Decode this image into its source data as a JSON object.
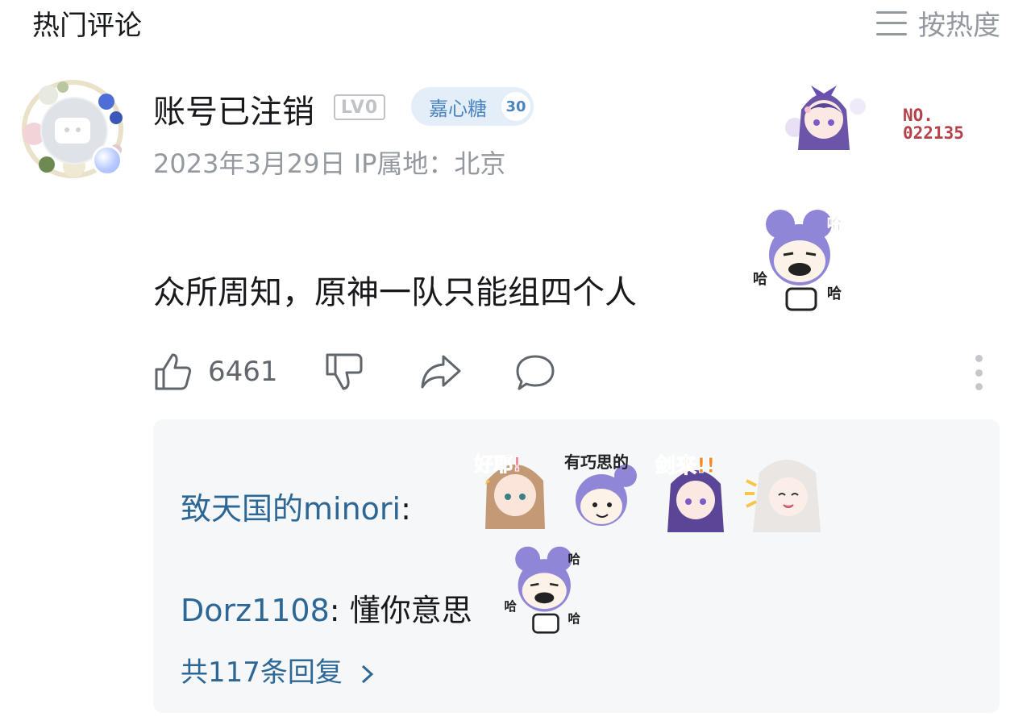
{
  "header": {
    "title": "热门评论",
    "sort_label": "按热度"
  },
  "comment": {
    "username": "账号已注销",
    "level": "LV0",
    "fan_badge": {
      "name": "嘉心糖",
      "level": "30"
    },
    "meta": "2023年3月29日 IP属地：北京",
    "decoration_number": [
      "NO.",
      "022135"
    ],
    "text": "众所周知，原神一队只能组四个人",
    "likes": "6461"
  },
  "replies": {
    "items": [
      {
        "name": "致天国的minori",
        "colon": ":",
        "text": ""
      },
      {
        "name": "Dorz1108",
        "colon": ":",
        "text": " 懂你意思"
      }
    ],
    "more_label": "共117条回复"
  },
  "colors": {
    "link_blue": "#2c6795",
    "reply_bg": "#f6f7f8",
    "muted": "#9499a0",
    "badge_bg": "#e3eef9",
    "badge_text": "#4c84c0",
    "decoration_red": "#b5424a",
    "sticker_purple": "#8f86d8"
  },
  "icons": [
    "menu-icon",
    "thumbs-up-icon",
    "thumbs-down-icon",
    "share-icon",
    "comment-icon",
    "more-vertical-icon",
    "chevron-right-icon"
  ]
}
